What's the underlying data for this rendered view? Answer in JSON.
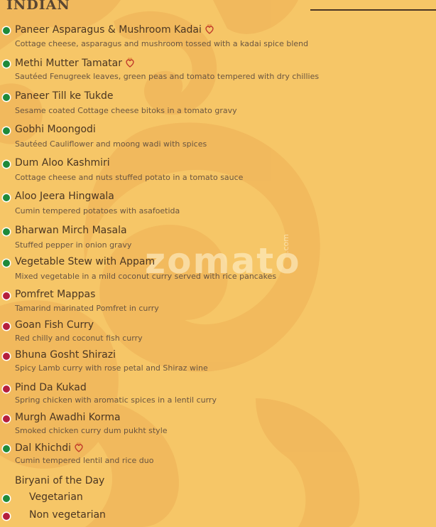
{
  "section_title": "INDIAN",
  "watermark": {
    "brand": "zomato",
    "tld": ".com"
  },
  "colors": {
    "veg": "#1f8a3a",
    "nonveg": "#b51f3d",
    "text": "#4b3622",
    "background": "#f6c667"
  },
  "items": [
    {
      "name": "Paneer Asparagus & Mushroom Kadai",
      "description": "Cottage cheese, asparagus and mushroom tossed with a kadai spice blend",
      "type": "veg",
      "chef_special": true
    },
    {
      "name": "Methi Mutter Tamatar",
      "description": "Sautéed Fenugreek leaves, green peas and tomato tempered with dry chillies",
      "type": "veg",
      "chef_special": true
    },
    {
      "name": "Paneer Till ke Tukde",
      "description": "Sesame coated Cottage cheese bitoks in a tomato gravy",
      "type": "veg",
      "chef_special": false
    },
    {
      "name": "Gobhi Moongodi",
      "description": "Sautéed Cauliflower and moong wadi with spices",
      "type": "veg",
      "chef_special": false
    },
    {
      "name": "Dum Aloo Kashmiri",
      "description": "Cottage cheese and nuts stuffed potato in a tomato sauce",
      "type": "veg",
      "chef_special": false
    },
    {
      "name": "Aloo Jeera Hingwala",
      "description": "Cumin tempered potatoes with asafoetida",
      "type": "veg",
      "chef_special": false
    },
    {
      "name": "Bharwan Mirch Masala",
      "description": "Stuffed pepper in onion gravy",
      "type": "veg",
      "chef_special": false
    },
    {
      "name": "Vegetable Stew with Appam",
      "description": "Mixed vegetable in a mild coconut curry served with rice pancakes",
      "type": "veg",
      "chef_special": false
    },
    {
      "name": "Pomfret Mappas",
      "description": "Tamarind marinated Pomfret in curry",
      "type": "nonveg",
      "chef_special": false
    },
    {
      "name": "Goan Fish Curry",
      "description": "Red chilly and coconut fish curry",
      "type": "nonveg",
      "chef_special": false
    },
    {
      "name": "Bhuna Gosht Shirazi",
      "description": "Spicy Lamb curry with rose petal and Shiraz wine",
      "type": "nonveg",
      "chef_special": false
    },
    {
      "name": "Pind Da Kukad",
      "description": "Spring chicken with aromatic spices in a lentil curry",
      "type": "nonveg",
      "chef_special": false
    },
    {
      "name": "Murgh Awadhi Korma",
      "description": "Smoked chicken curry dum pukht style",
      "type": "nonveg",
      "chef_special": false
    },
    {
      "name": "Dal Khichdi",
      "description": "Cumin tempered lentil and rice duo",
      "type": "veg",
      "chef_special": true
    }
  ],
  "biryani": {
    "title": "Biryani of the Day",
    "options": [
      {
        "label": "Vegetarian",
        "type": "veg"
      },
      {
        "label": "Non vegetarian",
        "type": "nonveg"
      }
    ]
  }
}
